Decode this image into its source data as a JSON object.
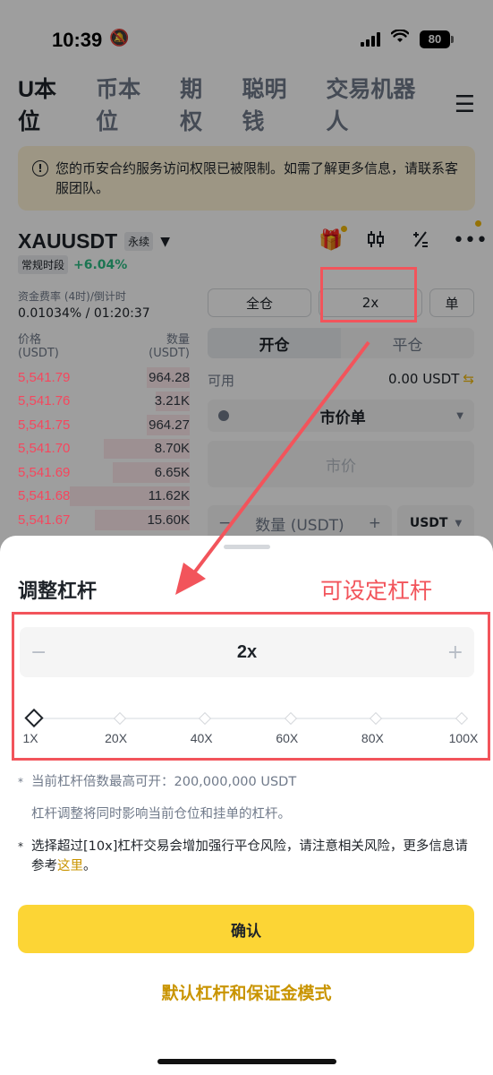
{
  "status": {
    "time": "10:39",
    "battery": "80"
  },
  "nav": {
    "tabs": [
      "U本位",
      "币本位",
      "期权",
      "聪明钱",
      "交易机器人"
    ],
    "menu_icon": "hamburger-icon"
  },
  "notice": {
    "text": "您的币安合约服务访问权限已被限制。如需了解更多信息，请联系客服团队。"
  },
  "pair": {
    "symbol": "XAUUSDT",
    "contract_type": "永续",
    "session": "常规时段",
    "change": "+6.04%"
  },
  "funding": {
    "label": "资金费率 (4时)/倒计时",
    "value": "0.01034% / 01:20:37"
  },
  "orderbook": {
    "price_header": "价格",
    "price_unit": "(USDT)",
    "qty_header": "数量",
    "qty_unit": "(USDT)",
    "rows": [
      {
        "price": "5,541.79",
        "qty": "964.28",
        "depth": 0.25
      },
      {
        "price": "5,541.76",
        "qty": "3.21K",
        "depth": 0.2
      },
      {
        "price": "5,541.75",
        "qty": "964.27",
        "depth": 0.25
      },
      {
        "price": "5,541.70",
        "qty": "8.70K",
        "depth": 0.5
      },
      {
        "price": "5,541.69",
        "qty": "6.65K",
        "depth": 0.45
      },
      {
        "price": "5,541.68",
        "qty": "11.62K",
        "depth": 0.7
      },
      {
        "price": "5,541.67",
        "qty": "15.60K",
        "depth": 0.55
      }
    ]
  },
  "trade": {
    "margin_mode": "全仓",
    "leverage": "2x",
    "position_mode": "单",
    "open_tab": "开仓",
    "close_tab": "平仓",
    "available_label": "可用",
    "available_value": "0.00 USDT",
    "order_type": "市价单",
    "price_placeholder": "市价",
    "qty_placeholder": "数量 (USDT)",
    "qty_unit": "USDT"
  },
  "annotation": {
    "label": "可设定杠杆"
  },
  "sheet": {
    "title": "调整杠杆",
    "leverage_value": "2x",
    "minus": "−",
    "plus": "+",
    "slider_labels": [
      "1X",
      "20X",
      "40X",
      "60X",
      "80X",
      "100X"
    ],
    "slider_position": 0.0,
    "note1": "当前杠杆倍数最高可开：200,000,000 USDT",
    "note2": "杠杆调整将同时影响当前仓位和挂单的杠杆。",
    "note3_prefix": "选择超过[10x]杠杆交易会增加强行平仓风险，请注意相关风险，更多信息请参考",
    "note3_link": "这里",
    "note3_suffix": "。",
    "star": "*",
    "confirm": "确认",
    "default_link": "默认杠杆和保证金模式"
  }
}
